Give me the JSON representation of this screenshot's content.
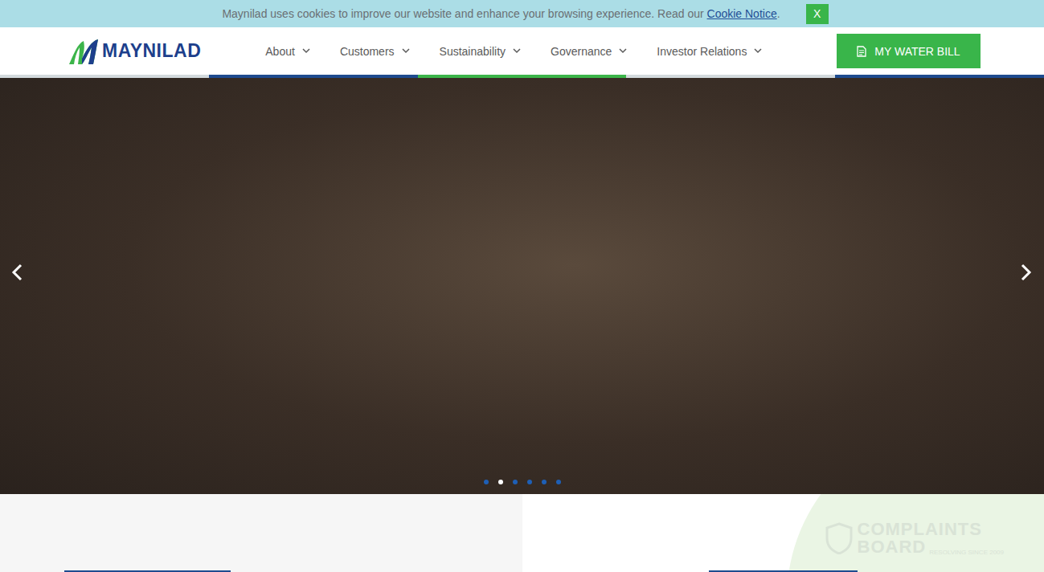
{
  "cookie_bar": {
    "text": "Maynilad uses cookies to improve our website and enhance your browsing experience. Read our ",
    "link": "Cookie Notice",
    "end": ".",
    "close": "X"
  },
  "logo": {
    "text": "MAYNILAD"
  },
  "nav": [
    {
      "label": "About"
    },
    {
      "label": "Customers"
    },
    {
      "label": "Sustainability"
    },
    {
      "label": "Governance"
    },
    {
      "label": "Investor Relations"
    }
  ],
  "bill_button": {
    "label": "MY WATER BILL"
  },
  "hero": {
    "dots": [
      {
        "selected": false
      },
      {
        "selected": true
      },
      {
        "selected": false
      },
      {
        "selected": false
      },
      {
        "selected": false
      },
      {
        "selected": false
      }
    ]
  },
  "watermark": {
    "line1": "COMPLAINTS",
    "line2": "BOARD",
    "tagline": "RESOLVING SINCE 2009"
  }
}
